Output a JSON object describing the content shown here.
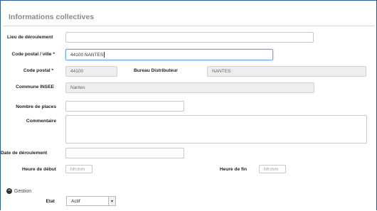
{
  "section": {
    "title": "Informations collectives",
    "gestion_label": "Gestion"
  },
  "fields": {
    "lieu": {
      "label": "Lieu de déroulement",
      "value": ""
    },
    "cp_ville": {
      "label": "Code postal / ville *",
      "value": "44100 NANTES"
    },
    "code_postal": {
      "label": "Code postal *",
      "value": "44100"
    },
    "bureau": {
      "label": "Bureau Distributeur",
      "value": "NANTES"
    },
    "commune": {
      "label": "Commune INSEE",
      "value": "Nantes"
    },
    "places": {
      "label": "Nombre de places",
      "value": ""
    },
    "commentaire": {
      "label": "Commentaire",
      "value": ""
    },
    "date": {
      "label": "Date de déroulement",
      "value": ""
    },
    "heure_debut": {
      "label": "Heure de début",
      "placeholder": "hh:mm"
    },
    "heure_fin": {
      "label": "Heure de fin",
      "placeholder": "hh:mm"
    },
    "etat": {
      "label": "Etat",
      "value": "Actif"
    }
  }
}
